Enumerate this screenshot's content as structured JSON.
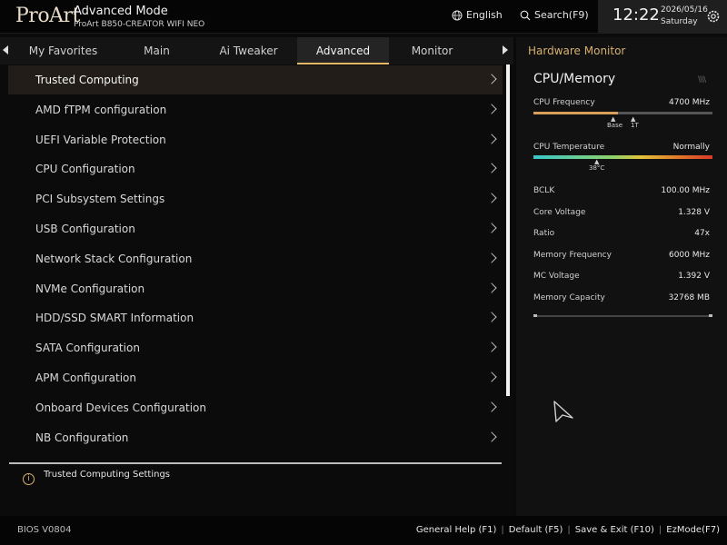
{
  "header": {
    "logo": "ProArt",
    "mode": "Advanced Mode",
    "model": "ProArt B850-CREATOR WIFI NEO",
    "language": "English",
    "search": "Search(F9)",
    "time": "12:22",
    "date": "2026/05/16",
    "day": "Saturday"
  },
  "tabs": [
    {
      "label": "My Favorites"
    },
    {
      "label": "Main"
    },
    {
      "label": "Ai Tweaker"
    },
    {
      "label": "Advanced"
    },
    {
      "label": "Monitor"
    }
  ],
  "active_tab": "Advanced",
  "menu": [
    {
      "label": "Trusted Computing",
      "selected": true
    },
    {
      "label": "AMD fTPM configuration"
    },
    {
      "label": "UEFI Variable Protection"
    },
    {
      "label": "CPU Configuration"
    },
    {
      "label": "PCI Subsystem Settings"
    },
    {
      "label": "USB Configuration"
    },
    {
      "label": "Network Stack Configuration"
    },
    {
      "label": "NVMe Configuration"
    },
    {
      "label": "HDD/SSD SMART Information"
    },
    {
      "label": "SATA Configuration"
    },
    {
      "label": "APM Configuration"
    },
    {
      "label": "Onboard Devices Configuration"
    },
    {
      "label": "NB Configuration"
    }
  ],
  "help": {
    "text": "Trusted Computing Settings"
  },
  "hardware_monitor": {
    "title": "Hardware Monitor",
    "section": "CPU/Memory",
    "cpu_frequency": {
      "label": "CPU Frequency",
      "value": "4700 MHz",
      "fill_fraction": 0.47,
      "base_label": "Base",
      "turbo_label": "1T"
    },
    "cpu_temperature": {
      "label": "CPU Temperature",
      "value": "Normally",
      "reading": "38°C"
    },
    "rows": [
      {
        "label": "BCLK",
        "value": "100.00 MHz"
      },
      {
        "label": "Core Voltage",
        "value": "1.328 V"
      },
      {
        "label": "Ratio",
        "value": "47x"
      },
      {
        "label": "Memory Frequency",
        "value": "6000 MHz"
      },
      {
        "label": "MC Voltage",
        "value": "1.392 V"
      },
      {
        "label": "Memory Capacity",
        "value": "32768 MB"
      }
    ]
  },
  "footer": {
    "bios": "BIOS V0804",
    "general_help": "General Help (F1)",
    "default": "Default (F5)",
    "save_exit": "Save & Exit (F10)",
    "ezmode": "EzMode(F7)"
  },
  "colors": {
    "accent": "#d6b070",
    "active_tab_underline": "#e8b86a",
    "selected_row": "#221d18"
  }
}
